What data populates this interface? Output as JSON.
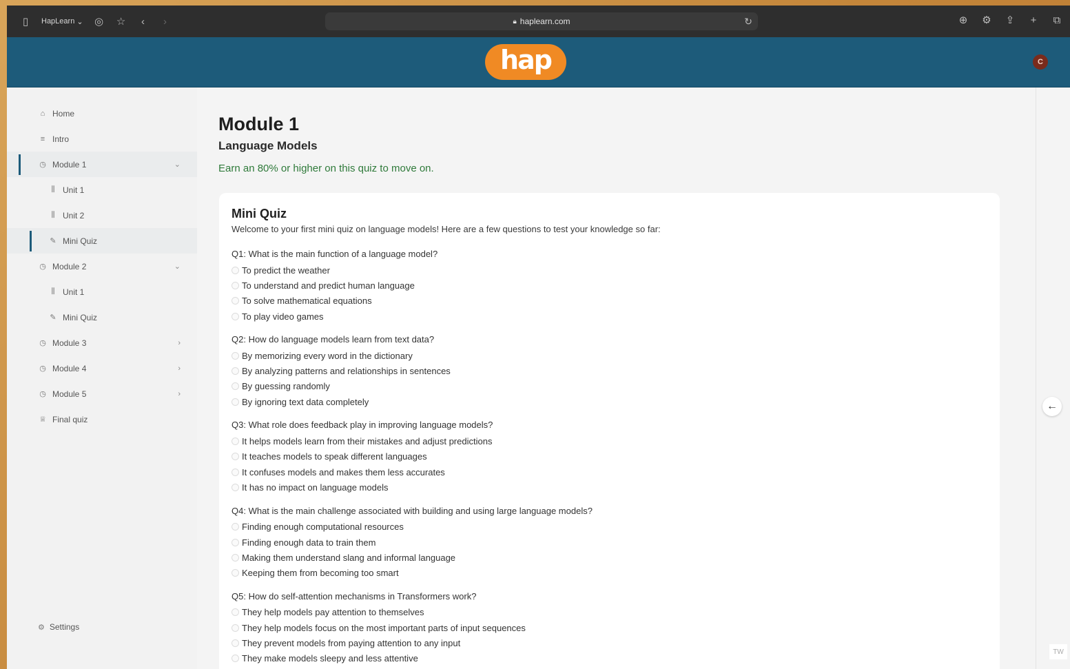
{
  "browser": {
    "tab_label": "HapLearn",
    "url": "haplearn.com"
  },
  "header": {
    "logo_text": "hap",
    "avatar_initial": "C"
  },
  "sidebar": {
    "items": [
      {
        "label": "Home",
        "icon": "home-icon",
        "level": 0
      },
      {
        "label": "Intro",
        "icon": "list-icon",
        "level": 0
      },
      {
        "label": "Module 1",
        "icon": "clock-icon",
        "level": 0,
        "chevron": "down",
        "active": true
      },
      {
        "label": "Unit 1",
        "icon": "book-icon",
        "level": 1
      },
      {
        "label": "Unit 2",
        "icon": "book-icon",
        "level": 1
      },
      {
        "label": "Mini Quiz",
        "icon": "edit-icon",
        "level": 1,
        "active": true
      },
      {
        "label": "Module 2",
        "icon": "clock-icon",
        "level": 0,
        "chevron": "down"
      },
      {
        "label": "Unit 1",
        "icon": "book-icon",
        "level": 1
      },
      {
        "label": "Mini Quiz",
        "icon": "edit-icon",
        "level": 1
      },
      {
        "label": "Module 3",
        "icon": "clock-icon",
        "level": 0,
        "chevron": "right"
      },
      {
        "label": "Module 4",
        "icon": "clock-icon",
        "level": 0,
        "chevron": "right"
      },
      {
        "label": "Module 5",
        "icon": "clock-icon",
        "level": 0,
        "chevron": "right"
      },
      {
        "label": "Final quiz",
        "icon": "trophy-icon",
        "level": 0
      }
    ],
    "settings_label": "Settings"
  },
  "main": {
    "title": "Module 1",
    "subtitle": "Language Models",
    "note": "Earn an 80% or higher on this quiz to move on.",
    "quiz": {
      "title": "Mini Quiz",
      "intro": "Welcome to your first mini quiz on language models! Here are a few questions to test your knowledge so far:",
      "questions": [
        {
          "text": "Q1: What is the main function of a language model?",
          "options": [
            "To predict the weather",
            "To understand and predict human language",
            "To solve mathematical equations",
            "To play video games"
          ]
        },
        {
          "text": "Q2: How do language models learn from text data?",
          "options": [
            "By memorizing every word in the dictionary",
            "By analyzing patterns and relationships in sentences",
            "By guessing randomly",
            "By ignoring text data completely"
          ]
        },
        {
          "text": "Q3: What role does feedback play in improving language models?",
          "options": [
            "It helps models learn from their mistakes and adjust predictions",
            "It teaches models to speak different languages",
            "It confuses models and makes them less accurates",
            "It has no impact on language models"
          ]
        },
        {
          "text": "Q4: What is the main challenge associated with building and using large language models?",
          "options": [
            "Finding enough computational resources",
            "Finding enough data to train them",
            "Making them understand slang and informal language",
            "Keeping them from becoming too smart"
          ]
        },
        {
          "text": "Q5: How do self-attention mechanisms in Transformers work?",
          "options": [
            "They help models pay attention to themselves",
            "They help models focus on the most important parts of input sequences",
            "They prevent models from paying attention to any input",
            "They make models sleepy and less attentive"
          ]
        }
      ]
    },
    "corner_badge": "TW"
  }
}
